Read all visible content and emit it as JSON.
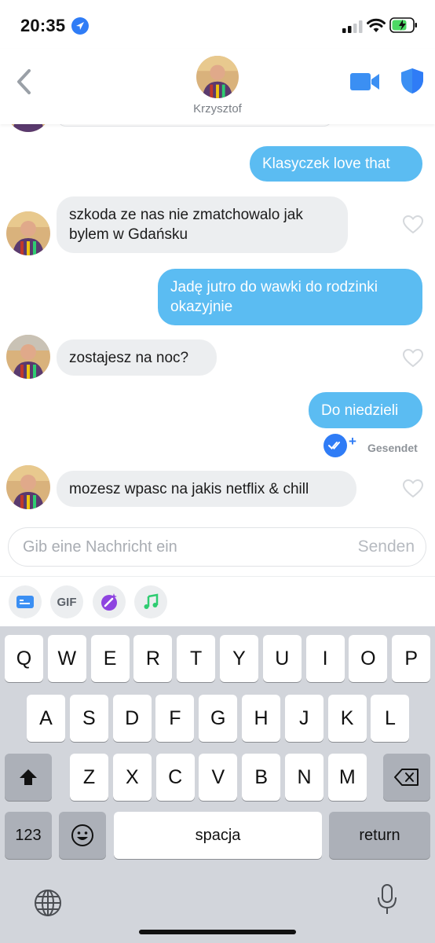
{
  "status_bar": {
    "time": "20:35"
  },
  "header": {
    "contact_name": "Krzysztof"
  },
  "messages": [
    {
      "direction": "out",
      "text": "Klasyczek love that"
    },
    {
      "direction": "in",
      "text": "szkoda ze nas nie zmatchowalo jak bylem w Gdańsku"
    },
    {
      "direction": "out",
      "text": "Jadę jutro do wawki do rodzinki okazyjnie"
    },
    {
      "direction": "in",
      "text": "zostajesz na noc?"
    },
    {
      "direction": "out",
      "text": "Do niedzieli"
    },
    {
      "direction": "in",
      "text": "mozesz wpasc na jakis netflix & chill"
    }
  ],
  "sent_status": "Gesendet",
  "composer": {
    "placeholder": "Gib eine Nachricht ein",
    "send_label": "Senden"
  },
  "tools": {
    "gif_label": "GIF"
  },
  "keyboard": {
    "row1": [
      "Q",
      "W",
      "E",
      "R",
      "T",
      "Y",
      "U",
      "I",
      "O",
      "P"
    ],
    "row2": [
      "A",
      "S",
      "D",
      "F",
      "G",
      "H",
      "J",
      "K",
      "L"
    ],
    "row3": [
      "Z",
      "X",
      "C",
      "V",
      "B",
      "N",
      "M"
    ],
    "numbers_label": "123",
    "space_label": "spacja",
    "return_label": "return"
  },
  "colors": {
    "outgoing_bubble": "#5bbcf2",
    "incoming_bubble": "#eceef0",
    "accent": "#2f7cf6"
  }
}
